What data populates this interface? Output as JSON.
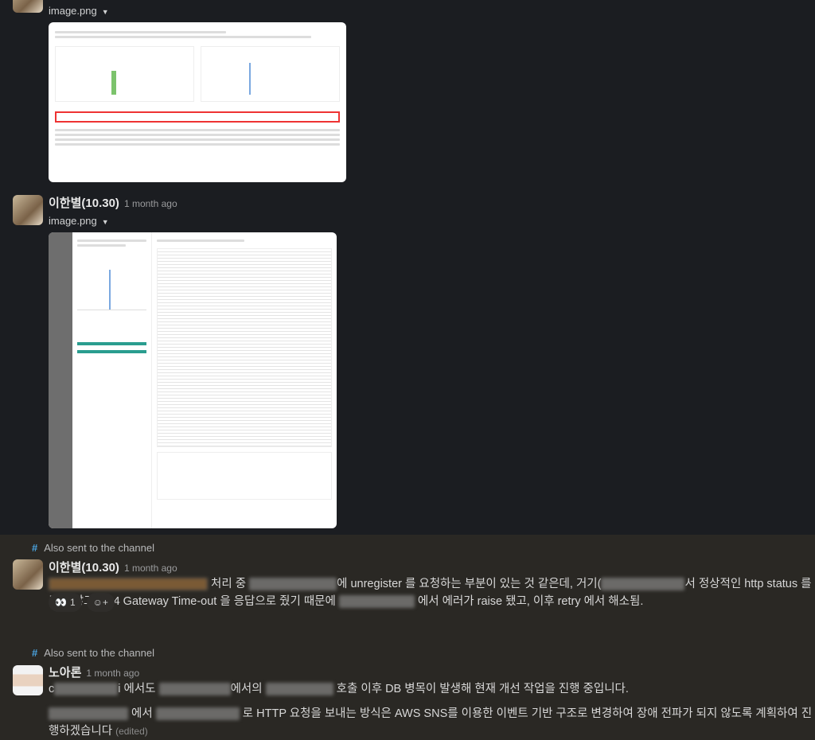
{
  "messages": [
    {
      "file_name": "image.png"
    },
    {
      "author": "이한별(10.30)",
      "time": "1 month ago",
      "file_name": "image.png"
    },
    {
      "also_sent": "Also sent to the channel",
      "author": "이한별(10.30)",
      "time": "1 month ago",
      "text_parts": [
        "처리 중 ",
        "에 unregister 를 요청하는 부분이 있는 것 같은데, 거기(",
        "서 정상적인 http status 를 주지 않고, 504 Gateway Time-out 을 응답으로 줬기 때문에 ",
        " 에서 에러가 raise 됐고, 이후 retry 에서 해소됨."
      ],
      "reaction": {
        "emoji": "👀",
        "count": "1"
      }
    },
    {
      "also_sent": "Also sent to the channel",
      "author": "노아론",
      "time": "1 month ago",
      "line1_parts": [
        "c",
        "i 에서도 ",
        "에서의 ",
        "호출 이후 DB 병목이 발생해 현재 개선 작업을 진행 중입니다."
      ],
      "line2_parts": [
        " 에서 ",
        " 로 HTTP 요청을 보내는 방식은 AWS SNS를 이용한 이벤트 기반 구조로 변경하여 장애 전파가 되지 않도록 계획하여 진행하겠습니다"
      ],
      "edited": "(edited)"
    }
  ]
}
